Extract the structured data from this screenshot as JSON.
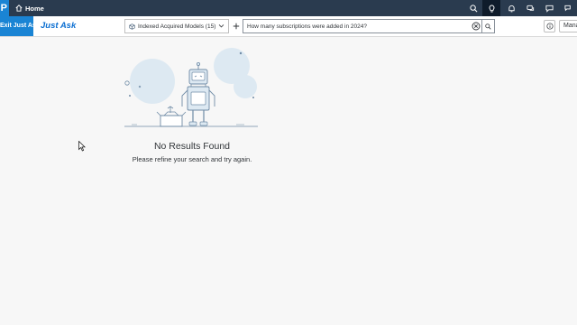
{
  "shell": {
    "logo_text": "P",
    "home_label": "Home",
    "icons": [
      "search-icon",
      "lightbulb-icon",
      "bell-icon",
      "chat-icon",
      "feedback-icon",
      "comments-icon"
    ]
  },
  "toolbar": {
    "exit_label": "Exit Just Ask",
    "app_title": "Just Ask",
    "model_select": {
      "value": "Indexed Acquired Models (15)"
    },
    "search": {
      "value": "How many subscriptions were added in 2024?"
    },
    "manage_label": "Manage"
  },
  "empty_state": {
    "title": "No Results Found",
    "subtitle": "Please refine your search and try again."
  },
  "colors": {
    "shell_bg": "#2a3b4f",
    "accent": "#1a84d4",
    "title_blue": "#0a6ed1",
    "illustration_fill": "#dde9f2",
    "illustration_stroke": "#6f8ba6"
  }
}
